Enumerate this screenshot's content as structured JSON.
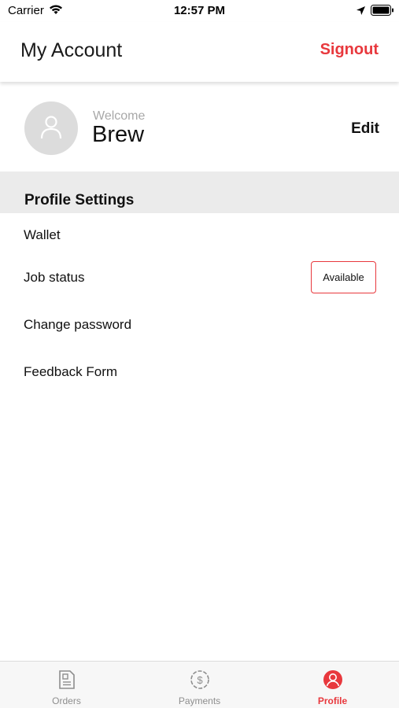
{
  "status_bar": {
    "carrier": "Carrier",
    "time": "12:57 PM"
  },
  "header": {
    "title": "My Account",
    "signout_label": "Signout"
  },
  "profile": {
    "welcome_label": "Welcome",
    "name": "Brew",
    "edit_label": "Edit"
  },
  "section": {
    "title": "Profile Settings"
  },
  "menu": {
    "wallet": "Wallet",
    "job_status": "Job status",
    "job_status_value": "Available",
    "change_password": "Change password",
    "feedback_form": "Feedback Form"
  },
  "tabs": [
    {
      "label": "Orders",
      "icon": "orders-icon",
      "active": false
    },
    {
      "label": "Payments",
      "icon": "payments-icon",
      "active": false
    },
    {
      "label": "Profile",
      "icon": "profile-icon",
      "active": true
    }
  ],
  "colors": {
    "accent": "#e8383d",
    "section_background": "#ebebeb",
    "avatar_background": "#dcdcdc",
    "inactive_tab": "#8e8e8e"
  }
}
